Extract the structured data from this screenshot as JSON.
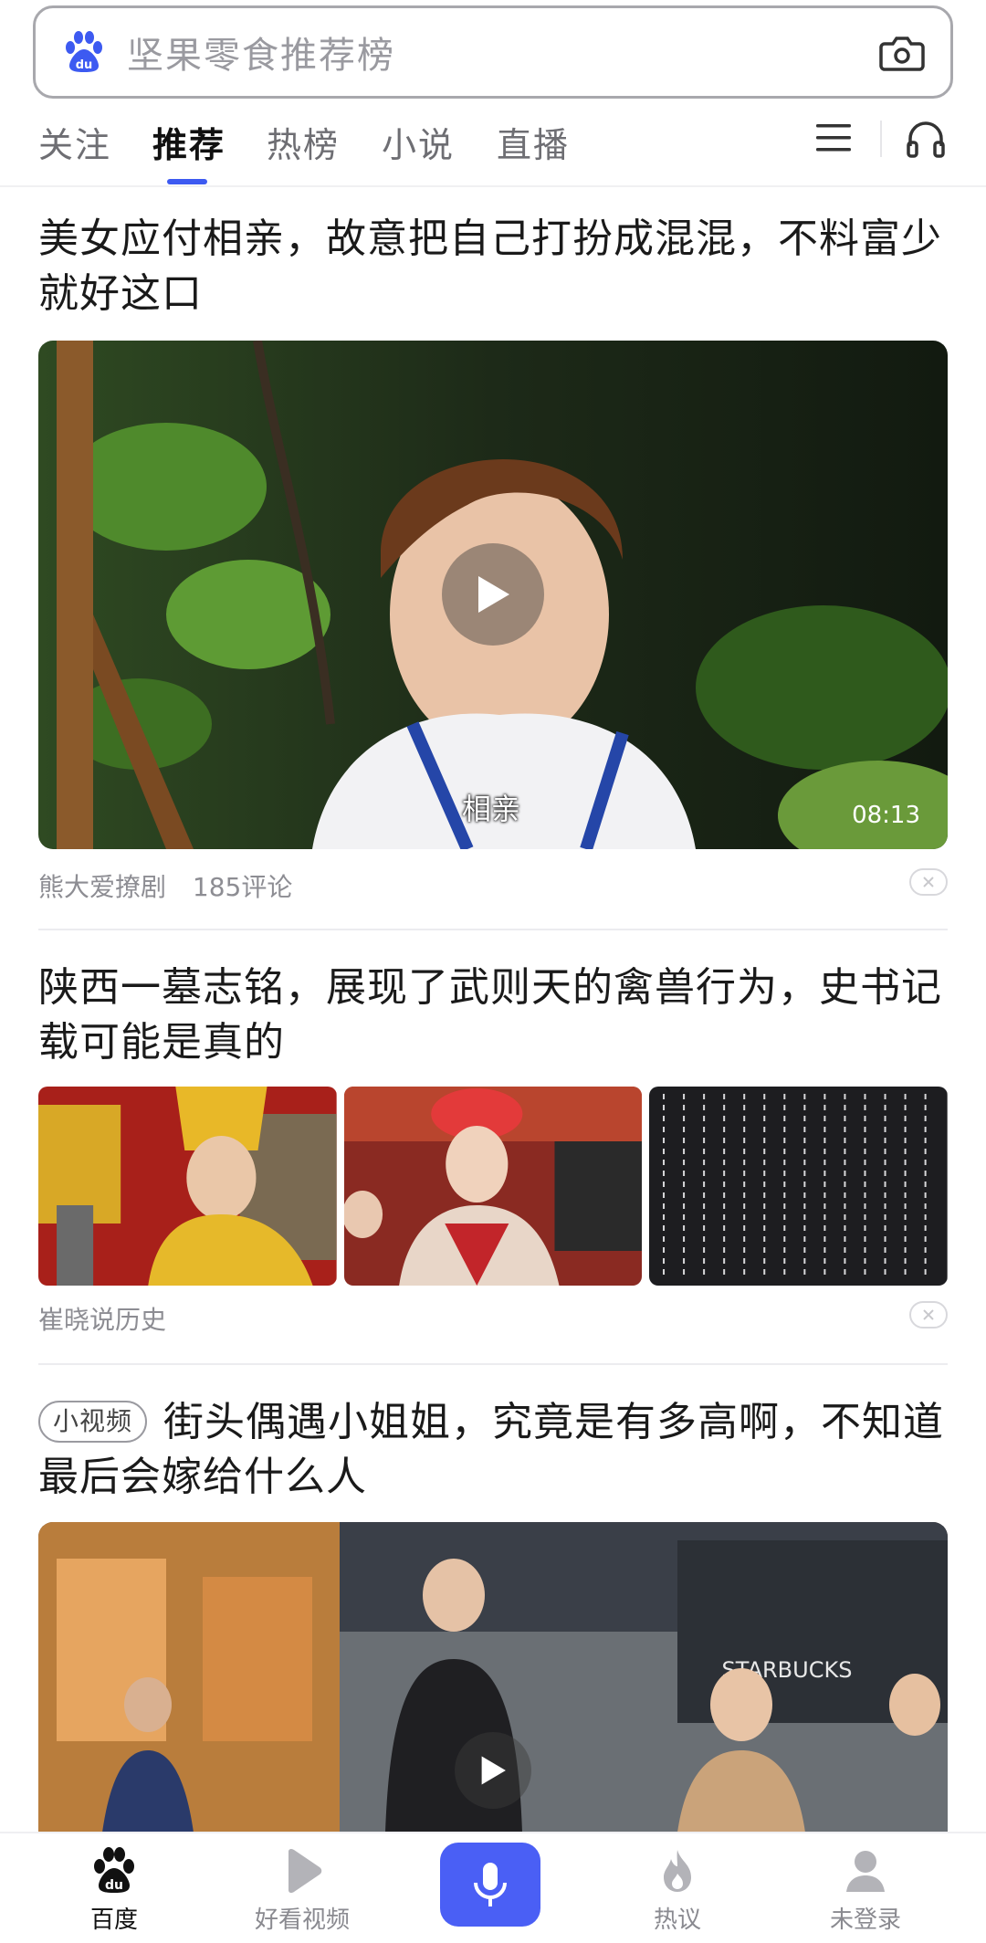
{
  "search": {
    "query": "坚果零食推荐榜",
    "logo_icon": "baidu-paw-logo",
    "camera_icon": "camera-icon"
  },
  "tabs": [
    {
      "label": "关注",
      "active": false
    },
    {
      "label": "推荐",
      "active": true
    },
    {
      "label": "热榜",
      "active": false
    },
    {
      "label": "小说",
      "active": false
    },
    {
      "label": "直播",
      "active": false
    }
  ],
  "feed": [
    {
      "type": "video",
      "title": "美女应付相亲，故意把自己打扮成混混，不料富少就好这口",
      "caption": "相亲",
      "duration": "08:13",
      "author": "熊大爱撩剧",
      "comments": "185评论"
    },
    {
      "type": "images",
      "title": "陕西一墓志铭，展现了武则天的禽兽行为，史书记载可能是真的",
      "author": "崔晓说历史"
    },
    {
      "type": "short-video",
      "tag": "小视频",
      "title": "街头偶遇小姐姐，究竟是有多高啊，不知道最后会嫁给什么人",
      "storefront_text": "STARBUCKS"
    }
  ],
  "bottom_nav": [
    {
      "label": "百度",
      "icon": "baidu-paw-icon",
      "active": true
    },
    {
      "label": "好看视频",
      "icon": "play-icon",
      "active": false
    },
    {
      "label": "",
      "icon": "microphone-icon",
      "active": false
    },
    {
      "label": "热议",
      "icon": "flame-icon",
      "active": false
    },
    {
      "label": "未登录",
      "icon": "user-icon",
      "active": false
    }
  ],
  "colors": {
    "accent": "#3d5af1",
    "voice_button": "#4a5ff5",
    "text_primary": "#1a1a1a",
    "text_muted": "#8d8d93"
  }
}
